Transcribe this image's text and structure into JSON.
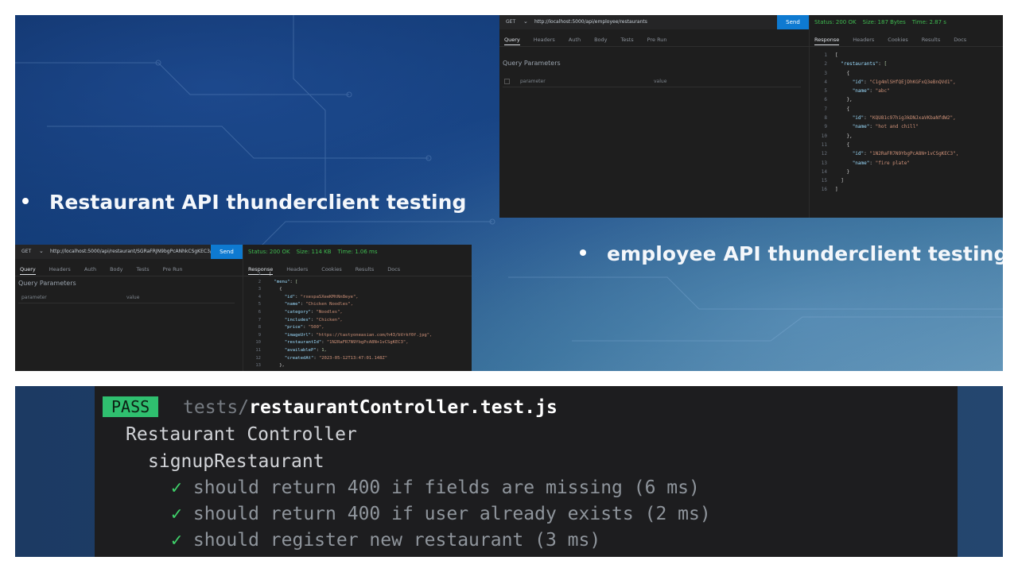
{
  "slide": {
    "bullet_restaurant": "Restaurant API thunderclient testing",
    "bullet_employee": "employee API thunderclient testing"
  },
  "thunder_top": {
    "method": "GET",
    "url": "http://localhost:5000/api/employee/restaurants",
    "send": "Send",
    "tabs": [
      "Query",
      "Headers",
      "Auth",
      "Body",
      "Tests",
      "Pre Run"
    ],
    "query_title": "Query Parameters",
    "param_key": "parameter",
    "param_value": "value",
    "status": "Status: 200 OK",
    "size": "Size: 187 Bytes",
    "time": "Time: 2.87 s",
    "response_tabs": [
      "Response",
      "Headers",
      "Cookies",
      "Results",
      "Docs"
    ],
    "code_lines": [
      "[",
      "  \"restaurants\": [",
      "    {",
      "      \"id\": \"C1g4mlSHfQEjDhKGFxQ3eBnQVd1\",",
      "      \"name\": \"abc\"",
      "    },",
      "    {",
      "      \"id\": \"KQU81c97hig3kDNJxaVKbaNfdW2\",",
      "      \"name\": \"hot and chill\"",
      "    },",
      "    {",
      "      \"id\": \"1N2RaFR7N9YbgPcA8N+1vCSgKEC3\",",
      "      \"name\": \"fire plate\"",
      "    }",
      "  ]",
      "]"
    ]
  },
  "thunder_bottom": {
    "method": "GET",
    "url": "http://localhost:5000/api/restaurant/SGRaFRJN9bgPcANhkCSgKEC3/menu",
    "send": "Send",
    "tabs": [
      "Query",
      "Headers",
      "Auth",
      "Body",
      "Tests",
      "Pre Run"
    ],
    "query_title": "Query Parameters",
    "param_key": "parameter",
    "param_value": "value",
    "status": "Status: 200 OK",
    "size": "Size: 114 KB",
    "time": "Time: 1.06 ms",
    "response_tabs": [
      "Response",
      "Headers",
      "Cookies",
      "Results",
      "Docs"
    ],
    "code_lines": [
      "[",
      "  \"menu\": [",
      "    {",
      "      \"id\": \"rxespaSXeeKMtNn8eye\",",
      "      \"name\": \"Chicken Noodles\",",
      "      \"category\": \"Noodles\",",
      "      \"includes\": \"Chicken\",",
      "      \"price\": \"500\",",
      "      \"imageUrl\": \"https://tastyoneasian.com/h43/bVrkf0f.jpg\",",
      "      \"restaurantId\": \"1N2RaFR7N9YbgPcA8N+1vCSgKEC3\",",
      "      \"availableP\": 1,",
      "      \"createdAt\": \"2023-05-12T13:47:01.148Z\"",
      "    },",
      "    {"
    ]
  },
  "terminal": {
    "pass_label": "PASS",
    "path_prefix": "tests/",
    "path_file": "restaurantController.test.js",
    "suite": "Restaurant Controller",
    "group": "signupRestaurant",
    "check": "✓",
    "tests": [
      "should return 400 if fields are missing (6 ms)",
      "should return 400 if user already exists (2 ms)",
      "should register new restaurant (3 ms)"
    ]
  }
}
